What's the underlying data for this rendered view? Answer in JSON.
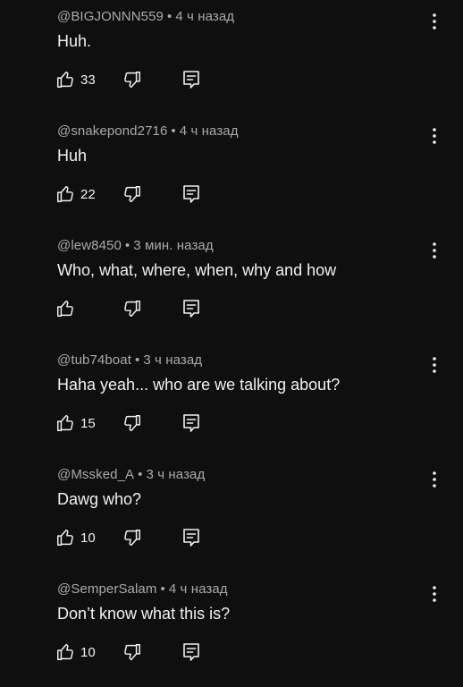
{
  "theme": {
    "background": "#0f0f0f",
    "primary_text": "#f1f1f1",
    "secondary_text": "#aaaaaa"
  },
  "comments": [
    {
      "author": "@BIGJONNN559",
      "separator": "•",
      "time": "4 ч назад",
      "text": "Huh.",
      "likes": "33"
    },
    {
      "author": "@snakepond2716",
      "separator": "•",
      "time": "4 ч назад",
      "text": "Huh",
      "likes": "22"
    },
    {
      "author": "@lew8450",
      "separator": "•",
      "time": "3 мин. назад",
      "text": "Who, what, where, when, why and how",
      "likes": ""
    },
    {
      "author": "@tub74boat",
      "separator": "•",
      "time": "3 ч назад",
      "text": "Haha yeah... who are we talking about?",
      "likes": "15"
    },
    {
      "author": "@Mssked_A",
      "separator": "•",
      "time": "3 ч назад",
      "text": "Dawg who?",
      "likes": "10"
    },
    {
      "author": "@SemperSalam",
      "separator": "•",
      "time": "4 ч назад",
      "text": "Don’t know what this is?",
      "likes": "10"
    }
  ],
  "icons": {
    "like": "thumbs-up-icon",
    "dislike": "thumbs-down-icon",
    "reply": "reply-comment-icon",
    "more": "more-vertical-icon"
  }
}
